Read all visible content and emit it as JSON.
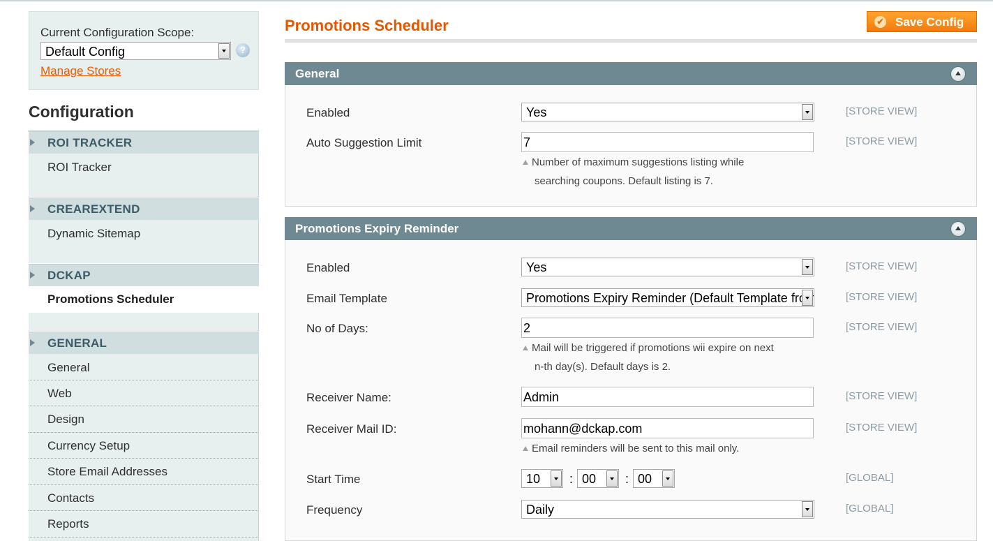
{
  "scope": {
    "label": "Current Configuration Scope:",
    "selected": "Default Config",
    "manage_link": "Manage Stores",
    "help_icon": "?"
  },
  "sidebar": {
    "title": "Configuration",
    "groups": [
      {
        "label": "ROI TRACKER",
        "items": [
          "ROI Tracker"
        ]
      },
      {
        "label": "CREAREXTEND",
        "items": [
          "Dynamic Sitemap"
        ]
      },
      {
        "label": "DCKAP",
        "items": [
          "Promotions Scheduler"
        ]
      },
      {
        "label": "GENERAL",
        "items": [
          "General",
          "Web",
          "Design",
          "Currency Setup",
          "Store Email Addresses",
          "Contacts",
          "Reports"
        ]
      }
    ]
  },
  "page": {
    "title": "Promotions Scheduler",
    "save_label": "Save Config"
  },
  "general": {
    "header": "General",
    "enabled_label": "Enabled",
    "enabled_value": "Yes",
    "enabled_scope": "[STORE VIEW]",
    "limit_label": "Auto Suggestion Limit",
    "limit_value": "7",
    "limit_scope": "[STORE VIEW]",
    "limit_note_1": "Number of maximum suggestions listing while",
    "limit_note_2": "searching coupons. Default listing is 7."
  },
  "expiry": {
    "header": "Promotions Expiry Reminder",
    "enabled_label": "Enabled",
    "enabled_value": "Yes",
    "enabled_scope": "[STORE VIEW]",
    "template_label": "Email Template",
    "template_value": "Promotions Expiry Reminder (Default Template from Locale)",
    "template_scope": "[STORE VIEW]",
    "days_label": "No of Days:",
    "days_value": "2",
    "days_scope": "[STORE VIEW]",
    "days_note_1": "Mail will be triggered if promotions wii expire on next",
    "days_note_2": "n-th day(s). Default days is 2.",
    "receiver_name_label": "Receiver Name:",
    "receiver_name_value": "Admin",
    "receiver_name_scope": "[STORE VIEW]",
    "receiver_mail_label": "Receiver Mail ID:",
    "receiver_mail_value": "mohann@dckap.com",
    "receiver_mail_scope": "[STORE VIEW]",
    "receiver_mail_note": "Email reminders will be sent to this mail only.",
    "start_label": "Start Time",
    "start_hour": "10",
    "start_minute": "00",
    "start_second": "00",
    "start_sep": ":",
    "start_scope": "[GLOBAL]",
    "frequency_label": "Frequency",
    "frequency_value": "Daily",
    "frequency_scope": "[GLOBAL]"
  },
  "colors": {
    "accent_orange": "#e25700",
    "section_header": "#6f8992",
    "sidebar_bg": "#e7efef",
    "scope_text": "#8c9aa3"
  }
}
